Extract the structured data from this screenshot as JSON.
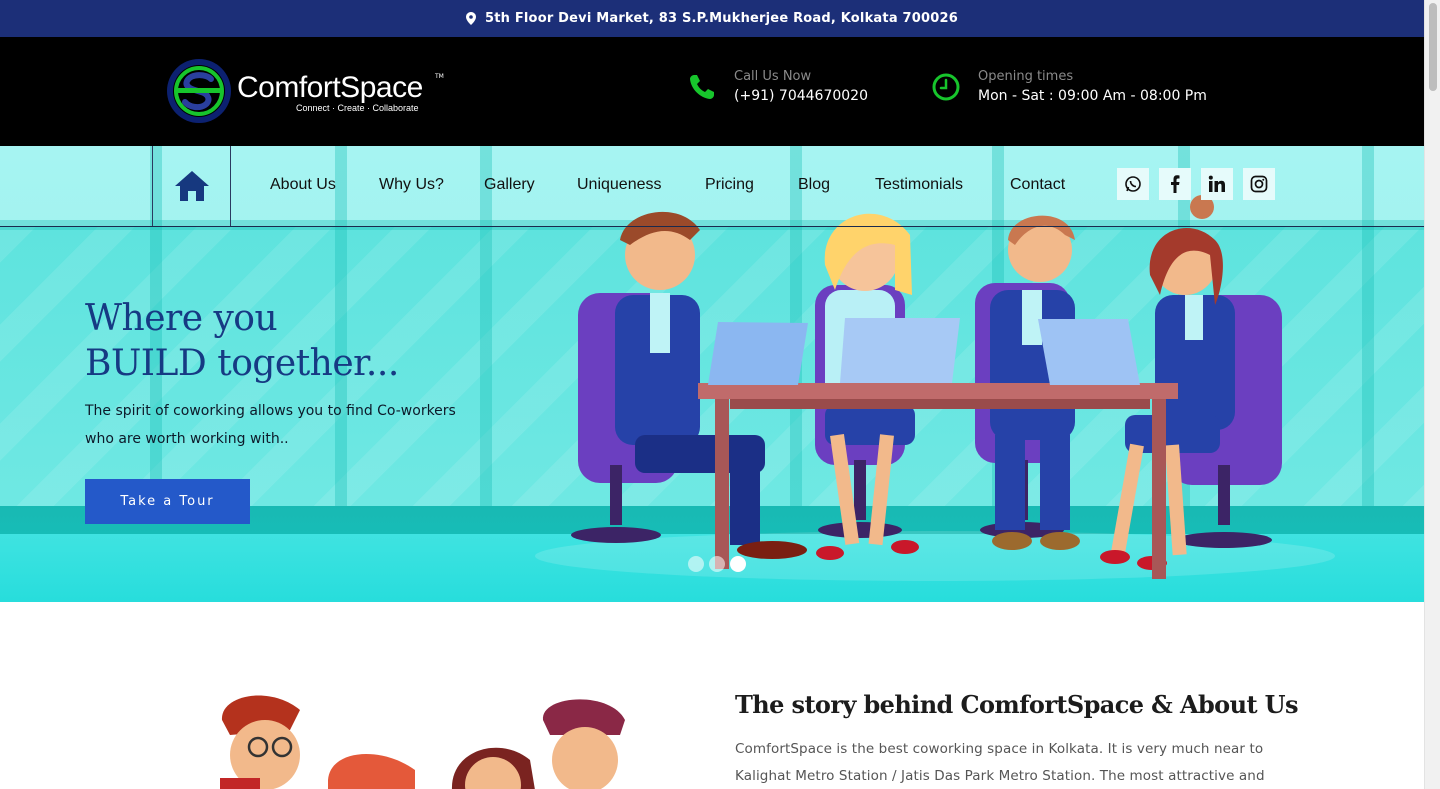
{
  "topbar": {
    "address": "5th Floor Devi Market, 83 S.P.Mukherjee Road, Kolkata 700026",
    "icon": "map-pin-icon"
  },
  "header": {
    "logo": {
      "brand": "ComfortSpace",
      "tagline": "Connect · Create · Collaborate",
      "tm": "TM"
    },
    "call": {
      "label": "Call Us Now",
      "value": "(+91) 7044670020",
      "icon": "phone-icon"
    },
    "hours": {
      "label": "Opening times",
      "value": "Mon - Sat : 09:00 Am - 08:00 Pm",
      "icon": "clock-icon"
    }
  },
  "nav": {
    "home_icon": "home-icon",
    "items": [
      {
        "label": "About Us"
      },
      {
        "label": "Why Us?"
      },
      {
        "label": "Gallery"
      },
      {
        "label": "Uniqueness"
      },
      {
        "label": "Pricing"
      },
      {
        "label": "Blog"
      },
      {
        "label": "Testimonials"
      },
      {
        "label": "Contact"
      }
    ],
    "social": [
      "whatsapp-icon",
      "facebook-icon",
      "linkedin-icon",
      "instagram-icon"
    ]
  },
  "hero": {
    "title_line1": "Where you",
    "title_line2": "BUILD together...",
    "subtitle": "The spirit of coworking allows you to find Co-workers who are worth working with..",
    "cta": "Take a Tour",
    "slides": 3,
    "active_slide": 3
  },
  "about": {
    "title": "The story behind ComfortSpace & About Us",
    "body": "ComfortSpace is the best coworking space in Kolkata. It is very much near to Kalighat Metro Station / Jatis Das Park Metro Station. The most attractive and"
  },
  "colors": {
    "topbar": "#1c2f78",
    "header": "#000000",
    "accent_green": "#16c22f",
    "hero_title": "#163a83",
    "cta": "#2459c9"
  }
}
